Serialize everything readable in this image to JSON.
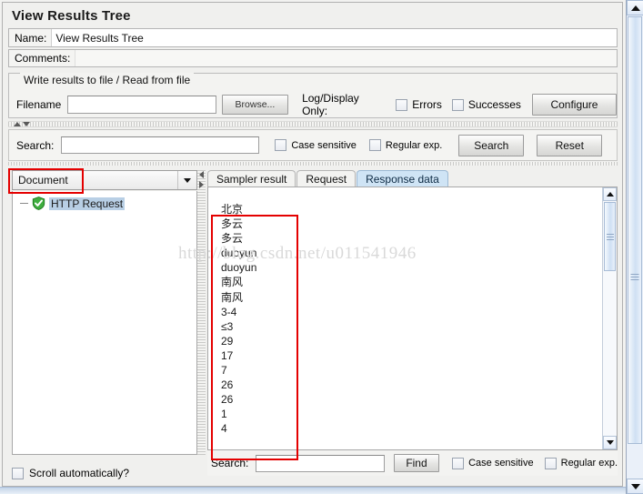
{
  "panel": {
    "title": "View Results Tree",
    "name_label": "Name:",
    "name_value": "View Results Tree",
    "comments_label": "Comments:",
    "comments_value": ""
  },
  "write_results": {
    "legend": "Write results to file / Read from file",
    "filename_label": "Filename",
    "filename_value": "",
    "browse_label": "Browse...",
    "log_display_label": "Log/Display Only:",
    "errors_label": "Errors",
    "successes_label": "Successes",
    "configure_label": "Configure"
  },
  "search_bar": {
    "label": "Search:",
    "value": "",
    "case_sensitive_label": "Case sensitive",
    "regular_exp_label": "Regular exp.",
    "search_button": "Search",
    "reset_button": "Reset"
  },
  "left_panel": {
    "renderer_selected": "Document",
    "tree_node_label": "HTTP Request",
    "tree_node_icon": "green-shield-check-icon",
    "scroll_automatically_label": "Scroll automatically?"
  },
  "right_panel": {
    "tabs": [
      {
        "label": "Sampler result",
        "active": false
      },
      {
        "label": "Request",
        "active": false
      },
      {
        "label": "Response data",
        "active": true
      }
    ],
    "response_text": "北京\n多云\n多云\nduoyun\nduoyun\n南风\n南风\n3-4\n≤3\n29\n17\n7\n26\n26\n1\n4",
    "find_bar": {
      "label": "Search:",
      "value": "",
      "find_button": "Find",
      "case_sensitive_label": "Case sensitive",
      "regular_exp_label": "Regular exp."
    }
  },
  "watermark": {
    "text": "http://blog.csdn.net/u011541946"
  },
  "annotations": {
    "highlight_color": "#e40000"
  }
}
